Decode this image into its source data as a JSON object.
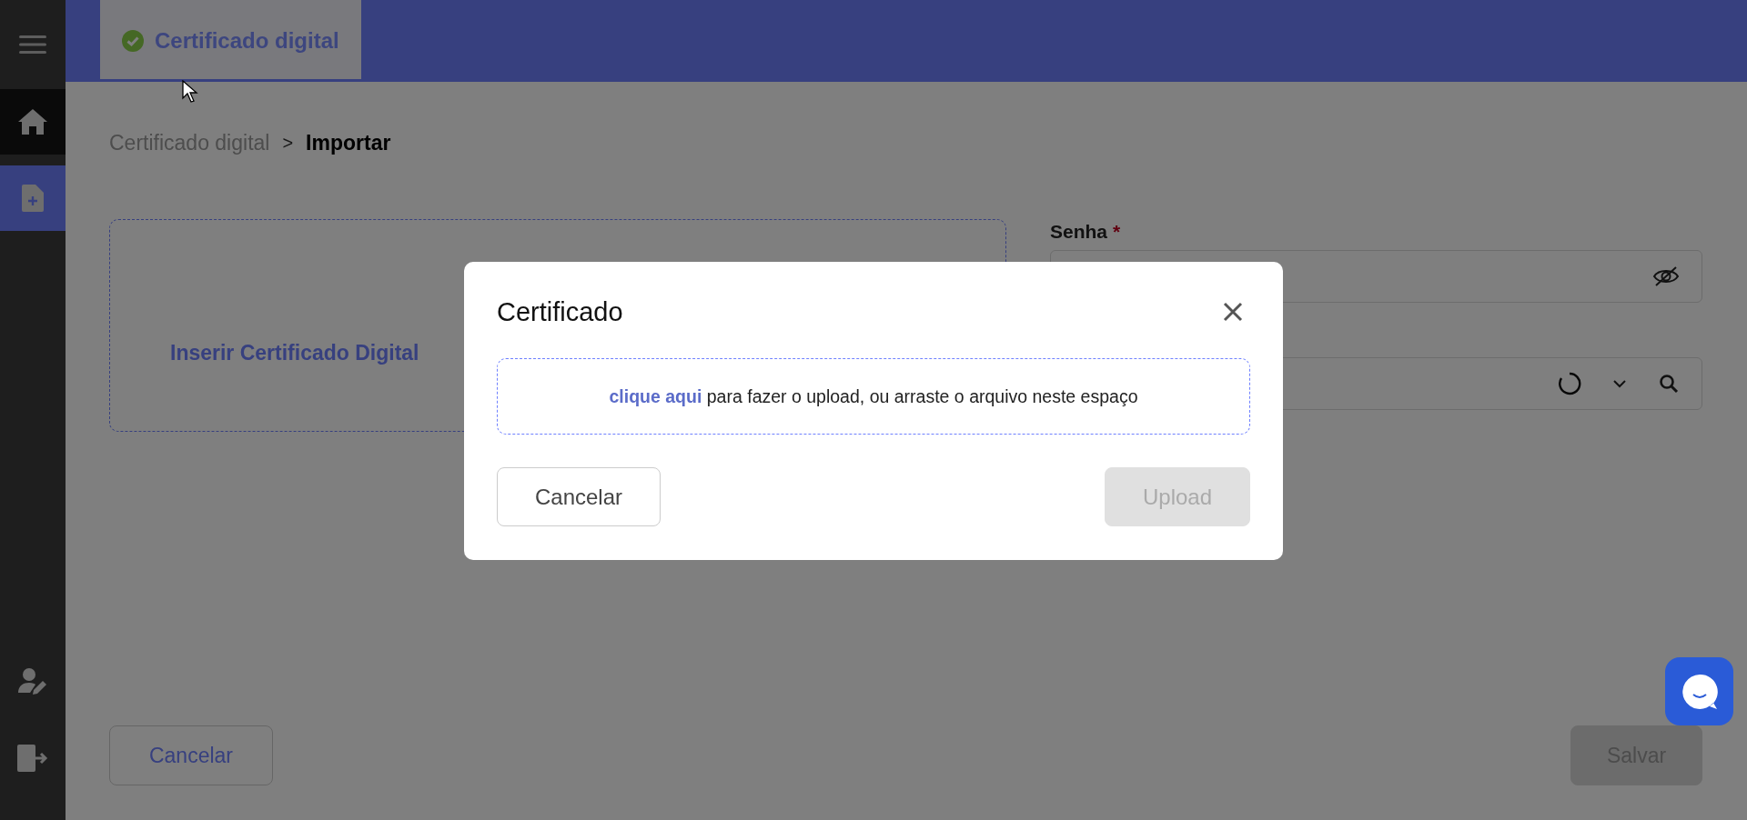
{
  "sidebar": {
    "items": [
      {
        "kind": "home",
        "selected": false,
        "hovered": true
      },
      {
        "kind": "document-add",
        "selected": true,
        "hovered": false
      }
    ],
    "bottom_items": [
      {
        "kind": "user-edit"
      },
      {
        "kind": "logout"
      }
    ]
  },
  "tabs": [
    {
      "label": "Certificado digital",
      "selected": true,
      "completed": true
    }
  ],
  "breadcrumb": {
    "items": [
      "Certificado digital",
      "Importar"
    ],
    "separator": ">"
  },
  "form": {
    "dropzone_label": "Inserir Certificado Digital",
    "password_field": {
      "label": "Senha",
      "required": true,
      "required_mark": "*"
    },
    "select_field": {
      "loading": true
    }
  },
  "footer_buttons": [
    {
      "label": "Cancelar",
      "disabled": false
    },
    {
      "label": "Salvar",
      "disabled": true
    }
  ],
  "modal": {
    "title": "Certificado",
    "dropzone": {
      "link": "clique aqui",
      "text": "para fazer o upload, ou arraste o arquivo neste espaço"
    },
    "buttons": [
      {
        "label": "Cancelar",
        "disabled": false
      },
      {
        "label": "Upload",
        "disabled": true
      }
    ]
  }
}
